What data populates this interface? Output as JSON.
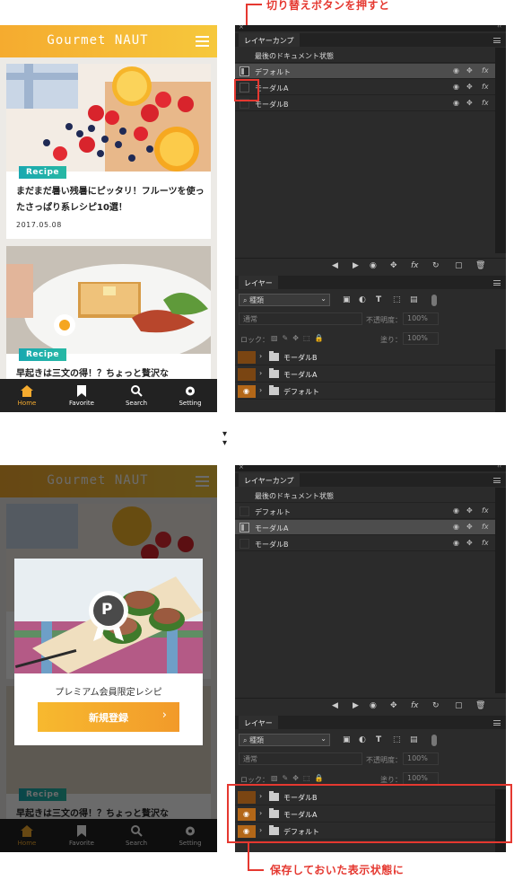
{
  "top_annotation": "切り替えボタンを押すと",
  "bottom_annotation": "保存しておいた表示状態に",
  "app": {
    "title": "Gourmet NAUT",
    "cards": [
      {
        "tag": "Recipe",
        "title": "まだまだ暑い残暑にピッタリ！フルーツを使ったさっぱり系レシピ10選！",
        "date": "2017.05.08"
      },
      {
        "tag": "Recipe",
        "title": "早起きは三文の得！？ちょっと贅沢な"
      }
    ],
    "tabs": [
      "Home",
      "Favorite",
      "Search",
      "Setting"
    ],
    "popup_text": "プレミアム会員限定レシピ",
    "popup_button": "新規登録",
    "popup_chevron": "›",
    "badge_letter": "P",
    "accent": "#f5ab2f"
  },
  "panel": {
    "comps_tab": "レイヤーカンプ",
    "layers_tab": "レイヤー",
    "comps": [
      "最後のドキュメント状態",
      "デフォルト",
      "モーダルA",
      "モーダルB"
    ],
    "filter_label": "種類",
    "blend_mode": "通常",
    "opacity_label": "不透明度：",
    "opacity_value": "100%",
    "lock_label": "ロック：",
    "fill_label": "塗り：",
    "fill_value": "100%",
    "fx": "fx",
    "layers": [
      "モーダルB",
      "モーダルA",
      "デフォルト"
    ]
  },
  "arrows": "▾"
}
